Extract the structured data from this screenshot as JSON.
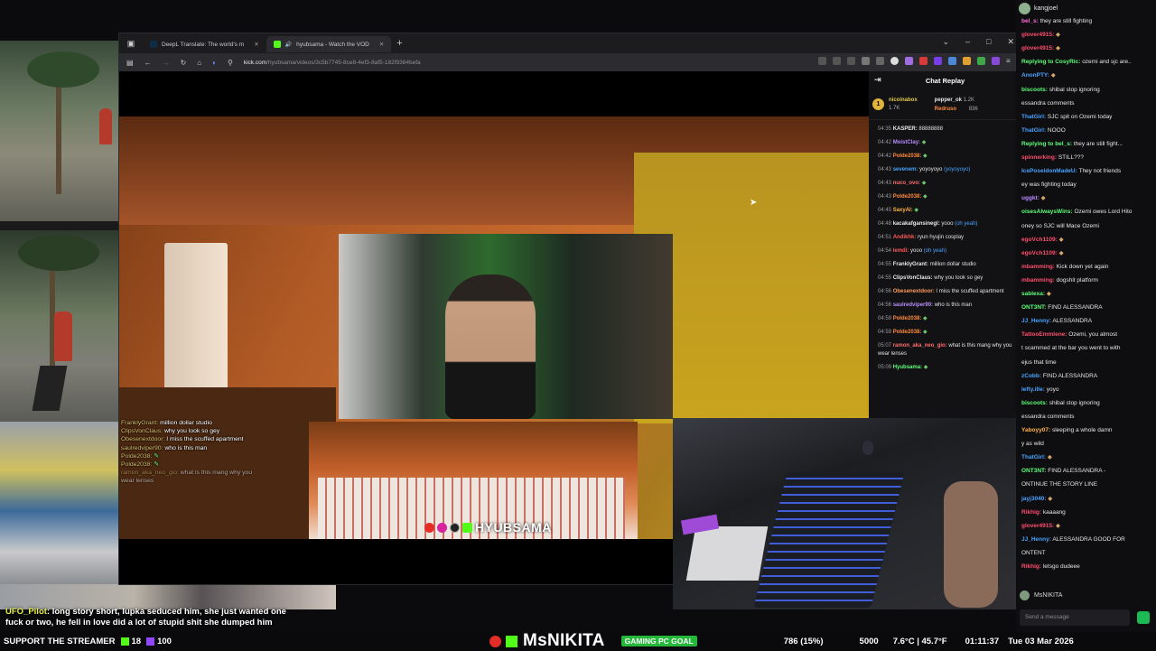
{
  "browser": {
    "tabs": [
      {
        "label": "DeepL Translate: The world's m"
      },
      {
        "label": "hyubsama - Watch the VOD"
      }
    ],
    "url_host": "kick.com",
    "url_path": "/hyubsama/videos/3c5b7745-8ce8-4ef3-8af5-182f9384befa"
  },
  "chat_replay": {
    "title": "Chat Replay",
    "leaderboard": [
      {
        "rank": "1",
        "name": "nicoinabox",
        "count": "1.7K"
      },
      {
        "name": "pepper_ok",
        "count": "1.2K"
      },
      {
        "name": "Redruso",
        "count": "836"
      }
    ],
    "messages": [
      {
        "time": "04:35",
        "name": "KASPER:",
        "text": "88888888",
        "color": "#e8e8e8"
      },
      {
        "time": "04:42",
        "name": "MoistClay:",
        "text": "",
        "color": "#b88cff"
      },
      {
        "time": "04:42",
        "name": "Polde2038:",
        "text": "",
        "color": "#ff8a3d"
      },
      {
        "time": "04:43",
        "name": "sevenem:",
        "text": "yoyoyoyo",
        "color": "#4aa3ff"
      },
      {
        "time": "04:43",
        "name": "nuco_ovo:",
        "text": "",
        "color": "#ff6e6e"
      },
      {
        "time": "04:43",
        "name": "Polde2038:",
        "text": "",
        "color": "#ff8a3d"
      },
      {
        "time": "04:45",
        "name": "SaxyAl:",
        "text": "",
        "color": "#ffb347"
      },
      {
        "time": "04:48",
        "name": "kacakafgansinegi:",
        "text": "yooo",
        "color": "#e8e8e8"
      },
      {
        "time": "04:51",
        "name": "Andikhk:",
        "text": "ryun hyujin cosplay",
        "color": "#ff5a5a"
      },
      {
        "time": "04:54",
        "name": "lemdi:",
        "text": "yooo",
        "color": "#ff5a5a"
      },
      {
        "time": "04:55",
        "name": "FranklyGrant:",
        "text": "million dollar studio",
        "color": "#e8e8e8"
      },
      {
        "time": "04:55",
        "name": "ClipsVonClaus:",
        "text": "why you look so gey",
        "color": "#e8e8e8"
      },
      {
        "time": "04:56",
        "name": "Obesenextdoor:",
        "text": "I miss the scuffed apartment",
        "color": "#ff9a5c"
      },
      {
        "time": "04:56",
        "name": "saulredviper90:",
        "text": "who is this man",
        "color": "#b88cff"
      },
      {
        "time": "04:59",
        "name": "Polde2038:",
        "text": "",
        "color": "#ff8a3d"
      },
      {
        "time": "04:59",
        "name": "Polde2038:",
        "text": "",
        "color": "#ff8a3d"
      },
      {
        "time": "05:07",
        "name": "ramon_aka_neo_gio:",
        "text": "what is this mang why you wear lenses",
        "color": "#ff6e6e"
      },
      {
        "time": "05:09",
        "name": "Hyubsama:",
        "text": "",
        "color": "#5dff7a"
      }
    ],
    "oh_yeah": "(oh yeah)",
    "yoyo": "(yoyoyoyo)"
  },
  "overlay_chat": [
    {
      "name": "FranklyGrant:",
      "text": "million dollar studio"
    },
    {
      "name": "ClipsVonClaus:",
      "text": "why you look so gey"
    },
    {
      "name": "Obesenextdoor:",
      "text": "I miss the scuffed apartment"
    },
    {
      "name": "saulredviper90:",
      "text": "who is this man"
    },
    {
      "name": "Polde2038:",
      "text": ""
    },
    {
      "name": "Polde2038:",
      "text": ""
    },
    {
      "name": "ramon_aka_neo_gio:",
      "text": "what is this mang why you wear lenses"
    }
  ],
  "stream_brand": {
    "name": "HYUBSAMA"
  },
  "right_chat": {
    "top_user": "kangjoel",
    "lines": [
      {
        "name": "bel_s:",
        "text": "they are still fighting",
        "color": "#ff6fd8"
      },
      {
        "name": "glover4915:",
        "text": "",
        "color": "#ff4f6e"
      },
      {
        "name": "glover4915:",
        "text": "",
        "color": "#ff4f6e"
      },
      {
        "name": "Replying to CosyRic:",
        "text": "ozemi and sjc are..",
        "color": "#5dff7a"
      },
      {
        "name": "AnonPTY:",
        "text": "",
        "color": "#4aa3ff"
      },
      {
        "name": "biscoots:",
        "text": "shibal stop ignoring",
        "color": "#5dff7a"
      },
      {
        "name": "",
        "text": "essandra comments",
        "color": "#e6e6e6"
      },
      {
        "name": "ThatGirl:",
        "text": "SJC spit on Ozemi today",
        "color": "#4aa3ff"
      },
      {
        "name": "ThatGirl:",
        "text": "NOOO",
        "color": "#4aa3ff"
      },
      {
        "name": "Replying to bel_s:",
        "text": "they are still fight...",
        "color": "#5dff7a"
      },
      {
        "name": "spinnerking:",
        "text": "STILL???",
        "color": "#ff4f6e"
      },
      {
        "name": "IcePoseidonMadeU:",
        "text": "They not friends",
        "color": "#4aa3ff"
      },
      {
        "name": "",
        "text": "ey was fighting today",
        "color": "#e6e6e6"
      },
      {
        "name": "uggkt:",
        "text": "",
        "color": "#b88cff"
      },
      {
        "name": "oisesAlwaysWins:",
        "text": "Ozemi owes Lord Hito",
        "color": "#5dff7a"
      },
      {
        "name": "",
        "text": "oney so SJC will Mace Ozemi",
        "color": "#e6e6e6"
      },
      {
        "name": "egoVch1109:",
        "text": "",
        "color": "#ff4f6e"
      },
      {
        "name": "egoVch1109:",
        "text": "",
        "color": "#ff4f6e"
      },
      {
        "name": "mbamming:",
        "text": "Kick down yet again",
        "color": "#ff4f6e"
      },
      {
        "name": "mbamming:",
        "text": "dogshit platform",
        "color": "#ff4f6e"
      },
      {
        "name": "sablexa:",
        "text": "",
        "color": "#5dff7a"
      },
      {
        "name": "ONT3NT:",
        "text": "FIND ALESSANDRA",
        "color": "#5dff7a"
      },
      {
        "name": "JJ_Henny:",
        "text": "ALESSANDRA",
        "color": "#4aa3ff"
      },
      {
        "name": "TattooEmmlene:",
        "text": "Ozemi, you almost",
        "color": "#ff4f6e"
      },
      {
        "name": "",
        "text": "t scammed at the bar you went to with",
        "color": "#e6e6e6"
      },
      {
        "name": "",
        "text": "ejus that time",
        "color": "#e6e6e6"
      },
      {
        "name": "zCobb:",
        "text": "FIND ALESSANDRA",
        "color": "#4aa3ff"
      },
      {
        "name": "lefty.ille:",
        "text": "yoyo",
        "color": "#4aa3ff"
      },
      {
        "name": "biscoots:",
        "text": "shibal stop ignoring",
        "color": "#5dff7a"
      },
      {
        "name": "",
        "text": "essandra comments",
        "color": "#e6e6e6"
      },
      {
        "name": "Yaboyy07:",
        "text": "sleeping a whole damn",
        "color": "#ffb347"
      },
      {
        "name": "",
        "text": "y as wild",
        "color": "#e6e6e6"
      },
      {
        "name": "ThatGirl:",
        "text": "",
        "color": "#4aa3ff"
      },
      {
        "name": "ONT3NT:",
        "text": "FIND ALESSANDRA -",
        "color": "#5dff7a"
      },
      {
        "name": "",
        "text": "ONTINUE THE STORY LINE",
        "color": "#e6e6e6"
      },
      {
        "name": "jayj3040:",
        "text": "",
        "color": "#4aa3ff"
      },
      {
        "name": "Rikhig:",
        "text": "kaaaang",
        "color": "#ff4f6e"
      },
      {
        "name": "glover4915:",
        "text": "",
        "color": "#ff4f6e"
      },
      {
        "name": "JJ_Henny:",
        "text": "ALESSANDRA GOOD FOR",
        "color": "#4aa3ff"
      },
      {
        "name": "",
        "text": "ONTENT",
        "color": "#e6e6e6"
      },
      {
        "name": "Rikhig:",
        "text": "letsgo dudeee",
        "color": "#ff4f6e"
      }
    ],
    "username": "MsNIKITA",
    "input_placeholder": "Send a message"
  },
  "caption": {
    "user": "UFO_Pilot",
    "text": ": long story short, lupka seduced him, she just wanted one fuck or two, he fell in love did a lot of stupid shit she dumped him"
  },
  "ticker": {
    "support": "SUPPORT THE STREAMER",
    "kick_count": "18",
    "sub_count": "100",
    "streamer": "MsNIKITA",
    "goal_label": "GAMING PC GOAL",
    "goal_progress": "786 (15%)",
    "goal_target": "5000",
    "weather": "7.6°C | 45.7°F",
    "clock": "01:11:37",
    "date": "Tue 03 Mar 2026"
  }
}
